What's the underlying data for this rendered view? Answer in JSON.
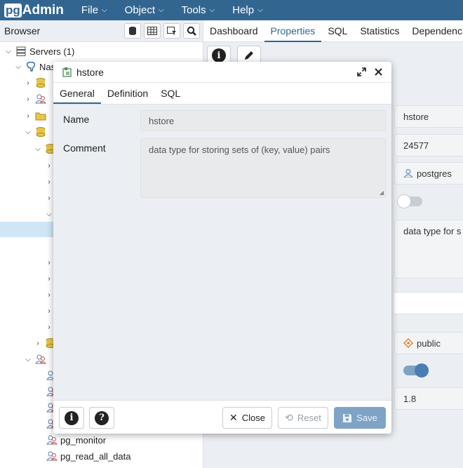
{
  "app": {
    "logo_pg": "pg",
    "logo_text": "Admin"
  },
  "menu": [
    {
      "label": "File"
    },
    {
      "label": "Object"
    },
    {
      "label": "Tools"
    },
    {
      "label": "Help"
    }
  ],
  "browser": {
    "title": "Browser"
  },
  "tabs": [
    {
      "label": "Dashboard"
    },
    {
      "label": "Properties"
    },
    {
      "label": "SQL"
    },
    {
      "label": "Statistics"
    },
    {
      "label": "Dependencies"
    }
  ],
  "tree": {
    "servers": "Servers (1)",
    "server": "Nas",
    "roles": [
      "pg_monitor",
      "pg_read_all_data"
    ]
  },
  "props": {
    "name": "hstore",
    "oid": "24577",
    "owner": "postgres",
    "comment": "data type for s",
    "schema": "public",
    "version": "1.8"
  },
  "dialog": {
    "title": "hstore",
    "tabs": [
      {
        "label": "General"
      },
      {
        "label": "Definition"
      },
      {
        "label": "SQL"
      }
    ],
    "name_label": "Name",
    "name_value": "hstore",
    "comment_label": "Comment",
    "comment_value": "data type for storing sets of (key, value) pairs",
    "close_label": "Close",
    "reset_label": "Reset",
    "save_label": "Save"
  },
  "colors": {
    "brand": "#326690",
    "accent": "#7ea3c6",
    "highlight": "#cfe6f5"
  }
}
